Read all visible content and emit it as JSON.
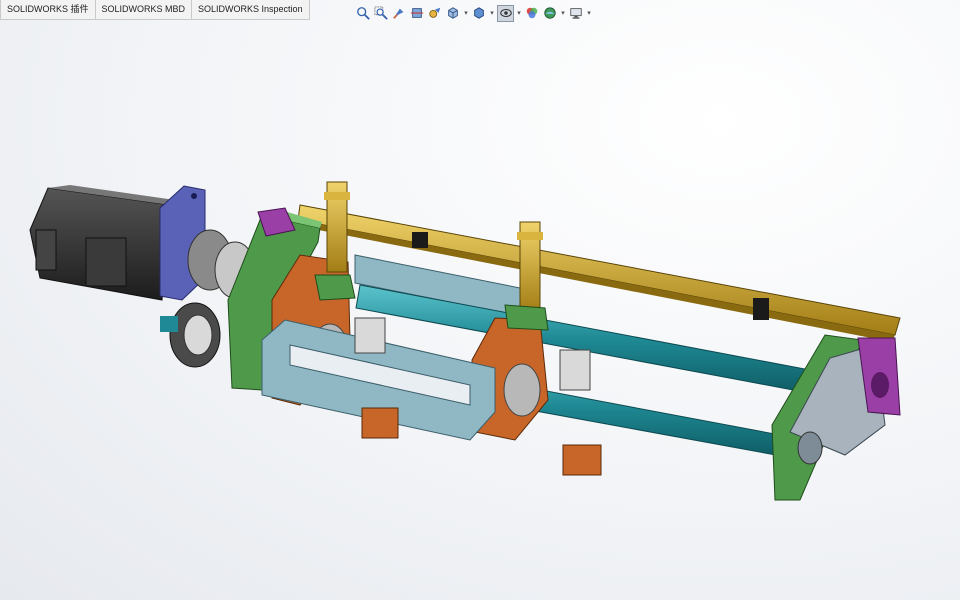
{
  "tabs": [
    {
      "label": "SOLIDWORKS 插件"
    },
    {
      "label": "SOLIDWORKS MBD"
    },
    {
      "label": "SOLIDWORKS Inspection"
    }
  ],
  "view_toolbar": [
    {
      "icon": "zoom-to-fit-icon"
    },
    {
      "icon": "zoom-to-area-icon"
    },
    {
      "icon": "previous-view-icon"
    },
    {
      "icon": "section-view-icon"
    },
    {
      "icon": "dynamic-annotation-icon"
    },
    {
      "icon": "view-orientation-icon",
      "dropdown": true
    },
    {
      "icon": "display-style-icon",
      "dropdown": true
    },
    {
      "icon": "hide-show-items-icon",
      "dropdown": true,
      "pressed": true
    },
    {
      "icon": "edit-appearance-icon"
    },
    {
      "icon": "apply-scene-icon",
      "dropdown": true
    },
    {
      "icon": "view-settings-icon",
      "dropdown": true
    }
  ],
  "colors": {
    "motor": "#2b2b2b",
    "flange": "#5a62b8",
    "frame_green": "#4f9a4a",
    "rail_gold": "#c9a22a",
    "slider_orange": "#c8662a",
    "shaft_cyan": "#1f8a95",
    "plate_gray": "#a8b3bd",
    "bracket_purple": "#9a3fa6"
  }
}
